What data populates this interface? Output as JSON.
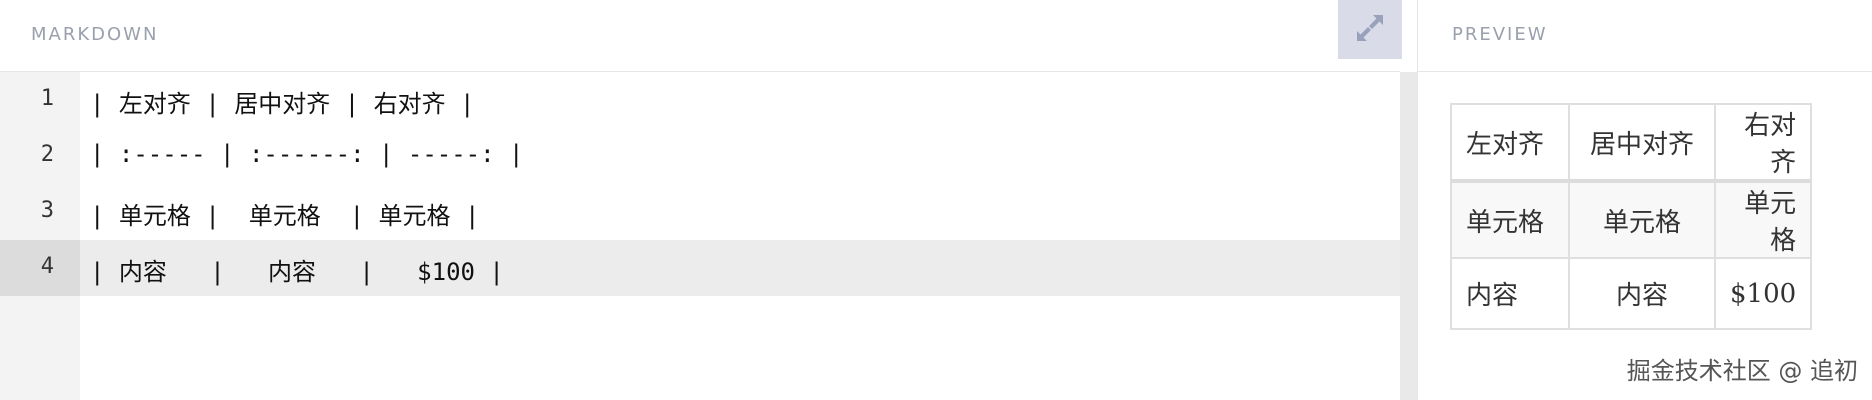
{
  "editor": {
    "title": "MARKDOWN",
    "expand_icon": "expand-arrows-icon",
    "active_line": 4,
    "lines": [
      {
        "num": "1",
        "text": "| 左对齐 | 居中对齐 | 右对齐 |"
      },
      {
        "num": "2",
        "text": "| :----- | :------: | -----: |"
      },
      {
        "num": "3",
        "text": "| 单元格 |  单元格  | 单元格 |"
      },
      {
        "num": "4",
        "text": "| 内容   |   内容   |   $100 |"
      }
    ]
  },
  "preview": {
    "title": "PREVIEW",
    "table": {
      "headers": [
        "左对齐",
        "居中对齐",
        "右对齐"
      ],
      "rows": [
        [
          "单元格",
          "单元格",
          "单元格"
        ],
        [
          "内容",
          "内容",
          "$100"
        ]
      ]
    }
  },
  "watermark": "掘金技术社区 @ 追初",
  "colors": {
    "header_text": "#9aa0ac",
    "expand_button_bg": "#d9dbe8",
    "active_line_bg": "#ececec",
    "gutter_bg": "#f3f3f3"
  }
}
